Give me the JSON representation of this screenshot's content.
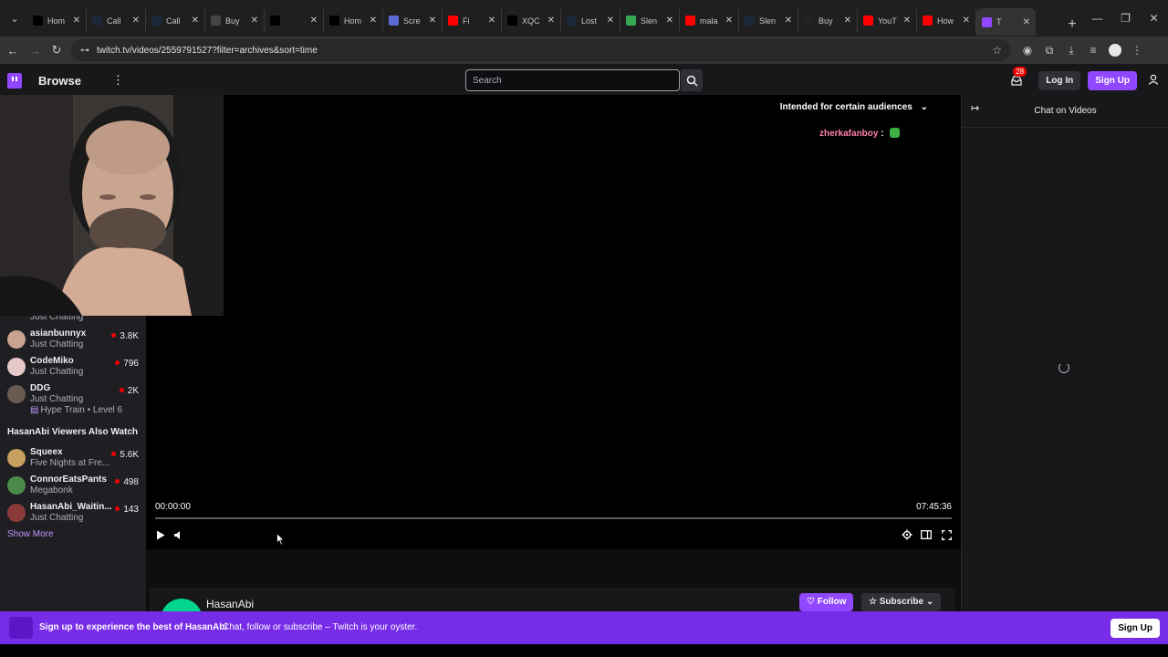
{
  "browser": {
    "tabs": [
      {
        "title": "Hom",
        "icon": "x-logo-icon",
        "color": "#000000"
      },
      {
        "title": "Call",
        "icon": "steam-icon",
        "color": "#1b2838"
      },
      {
        "title": "Call",
        "icon": "steam-icon",
        "color": "#1b2838"
      },
      {
        "title": "Buy",
        "icon": "loading-icon",
        "color": "#444444"
      },
      {
        "title": "",
        "icon": "x-logo-icon",
        "color": "#000000"
      },
      {
        "title": "Hom",
        "icon": "x-logo-icon",
        "color": "#000000"
      },
      {
        "title": "Scre",
        "icon": "screen-icon",
        "color": "#5b6bd5"
      },
      {
        "title": "Fi",
        "icon": "youtube-icon",
        "color": "#ff0000"
      },
      {
        "title": "XQC",
        "icon": "tiktok-icon",
        "color": "#000000"
      },
      {
        "title": "Lost",
        "icon": "steam-icon",
        "color": "#1b2838"
      },
      {
        "title": "Slen",
        "icon": "sheet-icon",
        "color": "#34a853"
      },
      {
        "title": "mala",
        "icon": "youtube-icon",
        "color": "#ff0000"
      },
      {
        "title": "Slen",
        "icon": "steam-icon",
        "color": "#1b2838"
      },
      {
        "title": "Buy",
        "icon": "github-icon",
        "color": "#222222"
      },
      {
        "title": "YouT",
        "icon": "youtube-icon",
        "color": "#ff0000"
      },
      {
        "title": "How",
        "icon": "youtube-icon",
        "color": "#ff0000"
      },
      {
        "title": "T",
        "icon": "twitch-icon",
        "color": "#9147ff",
        "active": true
      }
    ],
    "url": "twitch.tv/videos/2559791527?filter=archives&sort=time"
  },
  "topnav": {
    "browse": "Browse",
    "search_placeholder": "Search",
    "inbox_count": "28",
    "login": "Log In",
    "signup": "Sign Up"
  },
  "sidebar": {
    "partial_cat": "Just Chatting",
    "channels": [
      {
        "name": "asianbunnyx",
        "category": "Just Chatting",
        "viewers": "3.8K",
        "avatar_color": "#c9a38f"
      },
      {
        "name": "CodeMiko",
        "category": "Just Chatting",
        "viewers": "796",
        "avatar_color": "#e6c8c8"
      },
      {
        "name": "DDG",
        "category": "Just Chatting",
        "viewers": "2K",
        "avatar_color": "#6b5a52",
        "hype": "Hype Train • Level 6"
      }
    ],
    "also_watch_header": "HasanAbi Viewers Also Watch",
    "also_watch": [
      {
        "name": "Squeex",
        "category": "Five Nights at Fre...",
        "viewers": "5.6K",
        "avatar_color": "#c8a060"
      },
      {
        "name": "ConnorEatsPants",
        "category": "Megabonk",
        "viewers": "498",
        "avatar_color": "#4a8a4a"
      },
      {
        "name": "HasanAbi_Waitin...",
        "category": "Just Chatting",
        "viewers": "143",
        "avatar_color": "#8b3a3a"
      }
    ],
    "show_more": "Show More"
  },
  "player": {
    "audience_notice": "Intended for certain audiences",
    "chat_user": "zherkafanboy",
    "chat_sep": ":",
    "time_current": "00:00:00",
    "time_duration": "07:45:36",
    "progress": 0
  },
  "channel": {
    "name": "HasanAbi",
    "follow": "Follow",
    "subscribe": "Subscribe"
  },
  "chat": {
    "title": "Chat on Videos"
  },
  "banner": {
    "bold": "Sign up to experience the best of HasanAbi",
    "text": "Chat, follow or subscribe – Twitch is your oyster.",
    "button": "Sign Up"
  },
  "colors": {
    "accent": "#9147ff",
    "banner": "#772ce8",
    "live": "#eb0400"
  }
}
